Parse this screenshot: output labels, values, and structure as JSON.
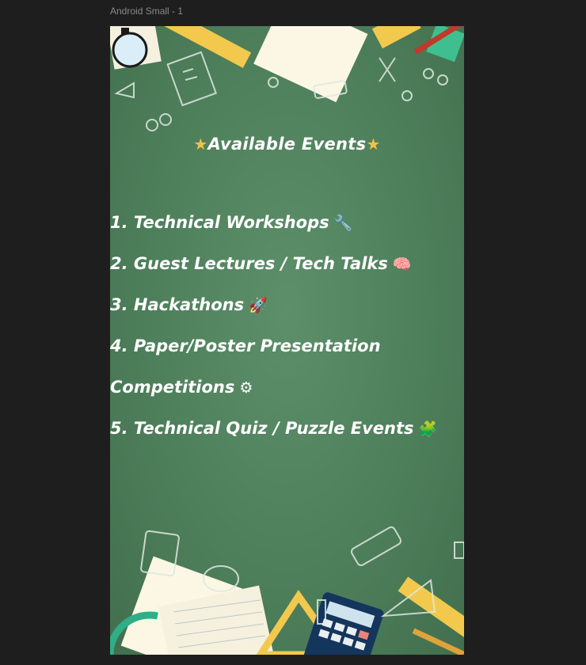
{
  "frame": {
    "label": "Android Small - 1"
  },
  "page": {
    "title": "Available Events",
    "title_icon": "star-icon",
    "events": [
      {
        "text": "1. Technical Workshops",
        "icon": "wrench-icon",
        "glyph": "🔧"
      },
      {
        "text": "2. Guest Lectures / Tech Talks",
        "icon": "brain-icon",
        "glyph": "🧠"
      },
      {
        "text": "3. Hackathons",
        "icon": "rocket-icon",
        "glyph": "🚀"
      },
      {
        "text": "4. Paper/Poster Presentation",
        "icon": "",
        "glyph": ""
      },
      {
        "text": "Competitions",
        "icon": "gear-icon",
        "glyph": "⚙"
      },
      {
        "text": "5. Technical Quiz / Puzzle Events",
        "icon": "puzzle-icon",
        "glyph": "🧩"
      }
    ]
  },
  "colors": {
    "background": "#1e1e1e",
    "chalkboard": "#4e7f5b",
    "star": "#f6c142",
    "text": "#ffffff"
  }
}
